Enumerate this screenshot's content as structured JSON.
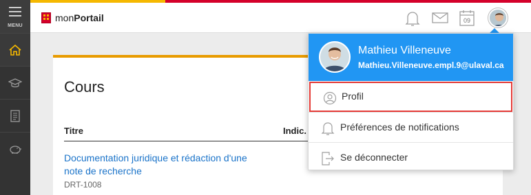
{
  "header": {
    "menu_label": "MENU",
    "brand_prefix": "mon",
    "brand_bold": "Portail",
    "calendar_day": "09"
  },
  "sidebar": {
    "items": [
      {
        "icon": "home-icon"
      },
      {
        "icon": "graduation-cap-icon"
      },
      {
        "icon": "document-icon"
      },
      {
        "icon": "piggy-bank-icon"
      }
    ]
  },
  "main": {
    "title": "Cours",
    "table": {
      "columns": [
        "Titre",
        "Indic."
      ],
      "rows": [
        {
          "title": "Documentation juridique et rédaction d'une note de recherche",
          "code": "DRT-1008"
        }
      ]
    }
  },
  "user_menu": {
    "name": "Mathieu Villeneuve",
    "email": "Mathieu.Villeneuve.empl.9@ulaval.ca",
    "items": [
      {
        "label": "Profil",
        "icon": "user-circle-icon"
      },
      {
        "label": "Préférences de notifications",
        "icon": "bell-icon"
      },
      {
        "label": "Se déconnecter",
        "icon": "logout-icon"
      }
    ]
  },
  "colors": {
    "accent_yellow": "#f5b800",
    "accent_red": "#d4002a",
    "card_accent": "#e89b00",
    "menu_header_blue": "#2196f3",
    "link_blue": "#1a73c9",
    "highlight_red": "#e53935"
  }
}
